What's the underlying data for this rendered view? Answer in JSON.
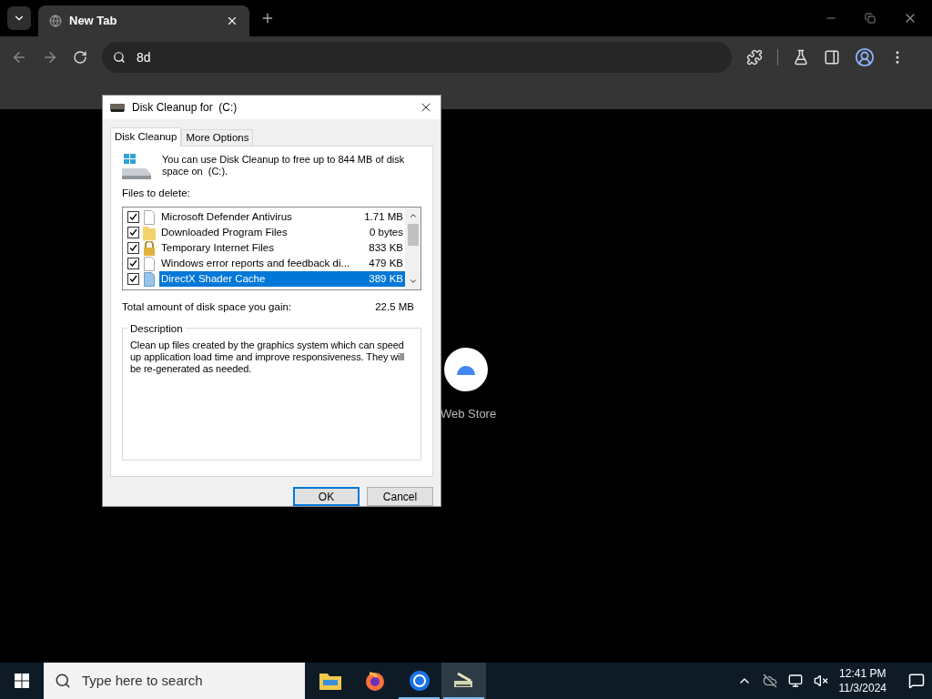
{
  "browser": {
    "tab_title": "New Tab",
    "address": "8d"
  },
  "shortcut": {
    "label": "Web Store"
  },
  "dialog": {
    "title": "Disk Cleanup for  (C:)",
    "tabs": [
      {
        "label": "Disk Cleanup",
        "selected": true
      },
      {
        "label": "More Options",
        "selected": false
      }
    ],
    "intro": "You can use Disk Cleanup to free up to 844 MB of disk space on  (C:).",
    "files_label": "Files to delete:",
    "files": [
      {
        "name": "Microsoft Defender Antivirus",
        "size": "1.71 MB",
        "checked": true,
        "selected": false,
        "kind": "file"
      },
      {
        "name": "Downloaded Program Files",
        "size": "0 bytes",
        "checked": true,
        "selected": false,
        "kind": "folder"
      },
      {
        "name": "Temporary Internet Files",
        "size": "833 KB",
        "checked": true,
        "selected": false,
        "kind": "lock"
      },
      {
        "name": "Windows error reports and feedback di...",
        "size": "479 KB",
        "checked": true,
        "selected": false,
        "kind": "file"
      },
      {
        "name": "DirectX Shader Cache",
        "size": "389 KB",
        "checked": true,
        "selected": true,
        "kind": "shader"
      }
    ],
    "total_label": "Total amount of disk space you gain:",
    "total_value": "22.5 MB",
    "description_label": "Description",
    "description": "Clean up files created by the graphics system which can speed up application load time and improve responsiveness. They will be re-generated as needed.",
    "ok": "OK",
    "cancel": "Cancel"
  },
  "taskbar": {
    "search_placeholder": "Type here to search",
    "apps": [
      {
        "kind": "explorer",
        "running": false,
        "selected": false
      },
      {
        "kind": "firefox",
        "running": false,
        "selected": false
      },
      {
        "kind": "chrome",
        "running": true,
        "selected": false
      },
      {
        "kind": "cleanup",
        "running": true,
        "selected": true
      }
    ],
    "time": "12:41 PM",
    "date": "11/3/2024"
  }
}
